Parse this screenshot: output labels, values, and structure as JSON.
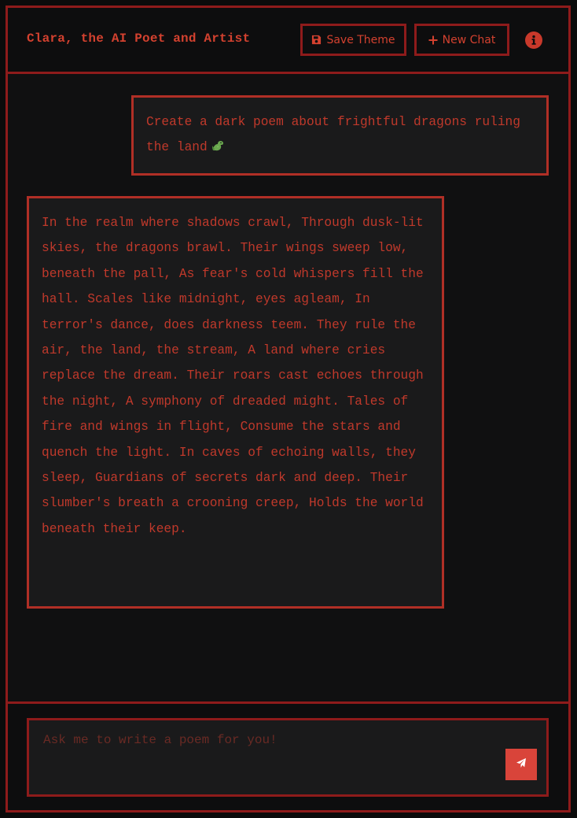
{
  "header": {
    "title": "Clara, the AI Poet and Artist",
    "save_theme_label": "Save Theme",
    "new_chat_label": "New Chat",
    "save_icon": "floppy-disk-icon",
    "new_chat_icon": "plus-icon",
    "info_icon": "info-circle-icon"
  },
  "chat": {
    "messages": [
      {
        "role": "user",
        "text": "Create a dark poem about frightful dragons ruling the land",
        "emoji": "dragon-icon"
      },
      {
        "role": "assistant",
        "text": "In the realm where shadows crawl, Through dusk-lit skies, the dragons brawl. Their wings sweep low, beneath the pall, As fear's cold whispers fill the hall. Scales like midnight, eyes agleam, In terror's dance, does darkness teem. They rule the air, the land, the stream, A land where cries replace the dream. Their roars cast echoes through the night, A symphony of dreaded might. Tales of fire and wings in flight, Consume the stars and quench the light. In caves of echoing walls, they sleep, Guardians of secrets dark and deep. Their slumber's breath a crooning creep, Holds the world beneath their keep."
      }
    ]
  },
  "composer": {
    "placeholder": "Ask me to write a poem for you!",
    "value": "",
    "send_icon": "paper-plane-icon"
  },
  "colors": {
    "accent": "#d3412f",
    "border": "#8e1b1b",
    "background": "#101011",
    "bubble": "#1a1a1b",
    "send_button": "#d9443a"
  }
}
